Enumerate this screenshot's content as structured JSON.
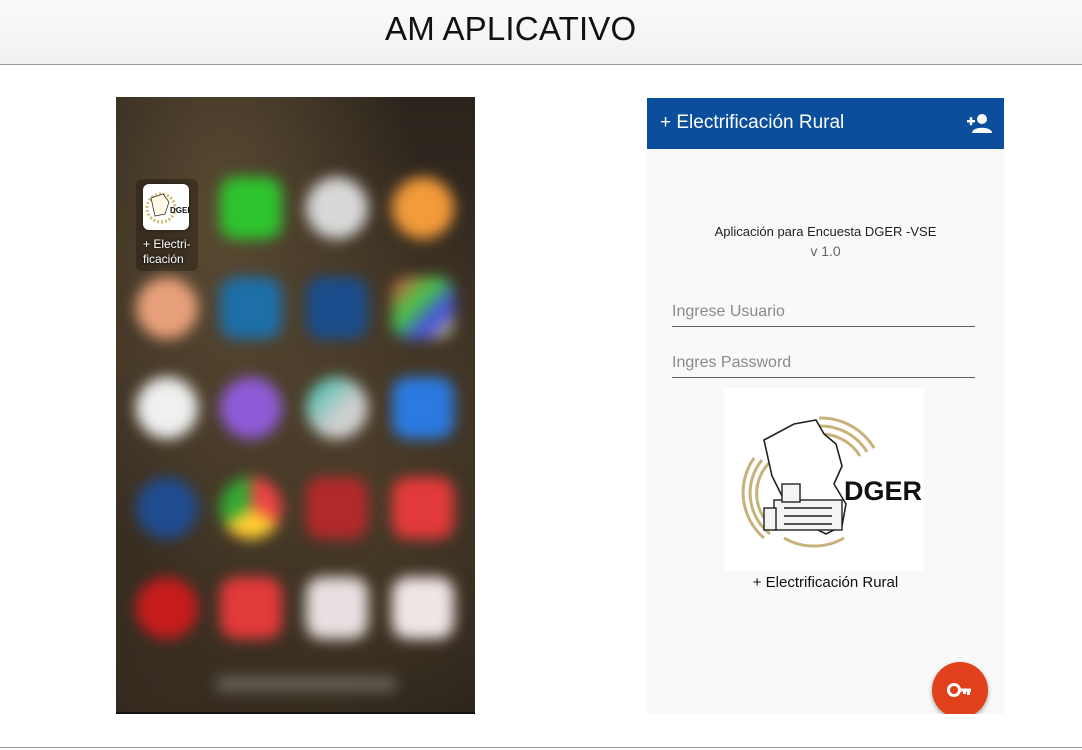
{
  "header": {
    "title": "AM APLICATIVO"
  },
  "home_screen": {
    "app_label": "+ Electri-\nficación",
    "app_icon_text": "DGER",
    "icon": "dger-app-icon"
  },
  "login_screen": {
    "appbar_title": "+ Electrificación Rural",
    "appbar_action_icon": "add-user-icon",
    "subtitle": "Aplicación para Encuesta DGER -VSE",
    "version": "v 1.0",
    "user_field": {
      "value": "",
      "placeholder": "Ingrese Usuario"
    },
    "password_field": {
      "value": "",
      "placeholder": "Ingres Password"
    },
    "logo_text": "DGER",
    "logo_caption": "+ Electrificación Rural",
    "fab_icon": "key-icon"
  },
  "colors": {
    "appbar": "#0b4f9c",
    "fab": "#e0401a",
    "logo_gold": "#c9b17a"
  }
}
